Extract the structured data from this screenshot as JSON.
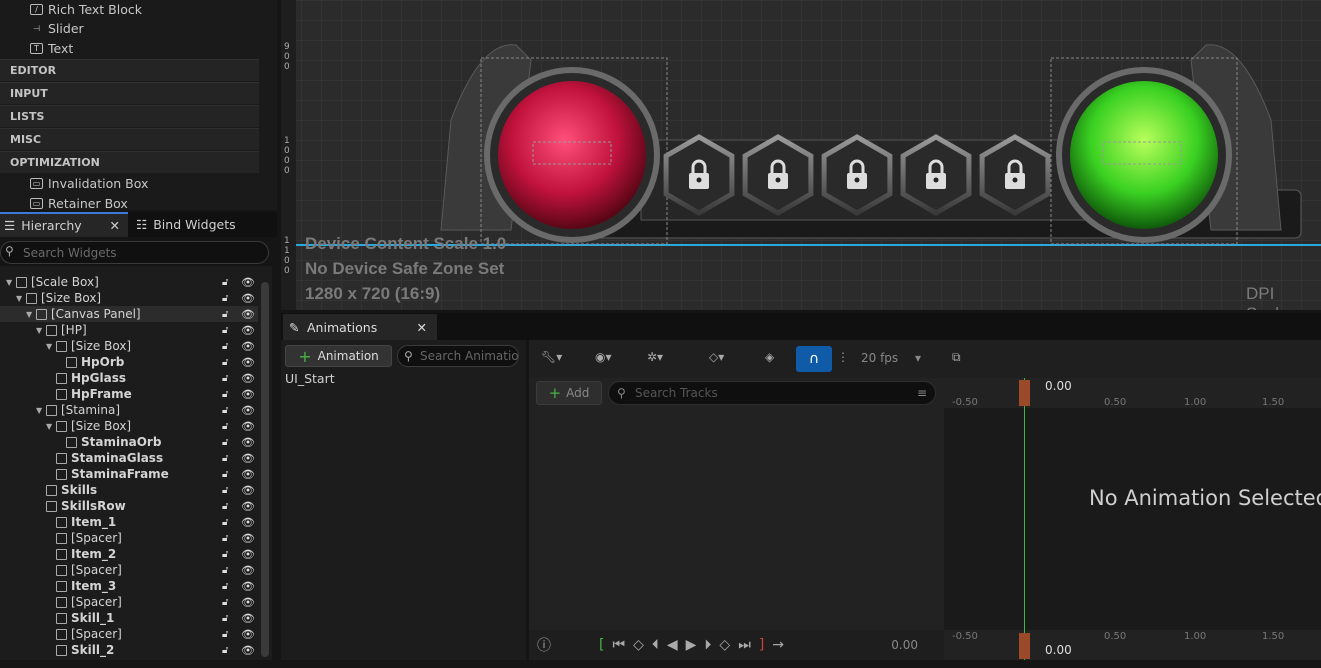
{
  "palette": {
    "items": [
      "Rich Text Block",
      "Slider",
      "Text"
    ],
    "categories": [
      "EDITOR",
      "INPUT",
      "LISTS",
      "MISC",
      "OPTIMIZATION"
    ],
    "opt_items": [
      "Invalidation Box",
      "Retainer Box"
    ]
  },
  "tabs": {
    "hierarchy": "Hierarchy",
    "bind": "Bind Widgets"
  },
  "search": {
    "placeholder": "Search Widgets"
  },
  "hierarchy": {
    "rows": [
      {
        "label": "[Scale Box]",
        "indent": 0,
        "bold": false
      },
      {
        "label": "[Size Box]",
        "indent": 1,
        "bold": false
      },
      {
        "label": "[Canvas Panel]",
        "indent": 2,
        "bold": false
      },
      {
        "label": "[HP]",
        "indent": 3,
        "bold": false
      },
      {
        "label": "[Size Box]",
        "indent": 4,
        "bold": false
      },
      {
        "label": "HpOrb",
        "indent": 5,
        "bold": true
      },
      {
        "label": "HpGlass",
        "indent": 4,
        "bold": true
      },
      {
        "label": "HpFrame",
        "indent": 4,
        "bold": true
      },
      {
        "label": "[Stamina]",
        "indent": 3,
        "bold": false
      },
      {
        "label": "[Size Box]",
        "indent": 4,
        "bold": false
      },
      {
        "label": "StaminaOrb",
        "indent": 5,
        "bold": true
      },
      {
        "label": "StaminaGlass",
        "indent": 4,
        "bold": true
      },
      {
        "label": "StaminaFrame",
        "indent": 4,
        "bold": true
      },
      {
        "label": "Skills",
        "indent": 3,
        "bold": true
      },
      {
        "label": "SkillsRow",
        "indent": 3,
        "bold": true
      },
      {
        "label": "Item_1",
        "indent": 4,
        "bold": true
      },
      {
        "label": "[Spacer]",
        "indent": 4,
        "bold": false
      },
      {
        "label": "Item_2",
        "indent": 4,
        "bold": true
      },
      {
        "label": "[Spacer]",
        "indent": 4,
        "bold": false
      },
      {
        "label": "Item_3",
        "indent": 4,
        "bold": true
      },
      {
        "label": "[Spacer]",
        "indent": 4,
        "bold": false
      },
      {
        "label": "Skill_1",
        "indent": 4,
        "bold": true
      },
      {
        "label": "[Spacer]",
        "indent": 4,
        "bold": false
      },
      {
        "label": "Skill_2",
        "indent": 4,
        "bold": true
      }
    ]
  },
  "viewport": {
    "lines": [
      "Device Content Scale 1.0",
      "No Device Safe Zone Set",
      "1280 x 720 (16:9)"
    ],
    "dpi": "DPI Scale",
    "ruler_labels": [
      "9",
      "0",
      "0",
      "1",
      "0",
      "0",
      "0",
      "1",
      "1",
      "0",
      "0"
    ]
  },
  "animations": {
    "tab": "Animations",
    "add_label": "Animation",
    "search_placeholder": "Search Animations",
    "list": [
      "UI_Start"
    ],
    "fps": "20 fps",
    "track_add": "Add",
    "track_search": "Search Tracks",
    "time": "0.00",
    "time_bottom": "0.00",
    "playtime": "0.00",
    "ticks": [
      "-0.50",
      "0.50",
      "1.00",
      "1.50"
    ],
    "empty_msg": "No Animation Selected"
  },
  "colors": {
    "accent": "#3d7ad6",
    "playhead": "#c86a3a",
    "green": "#46b346",
    "hp": "#c0123c",
    "stamina": "#4fd62a"
  }
}
